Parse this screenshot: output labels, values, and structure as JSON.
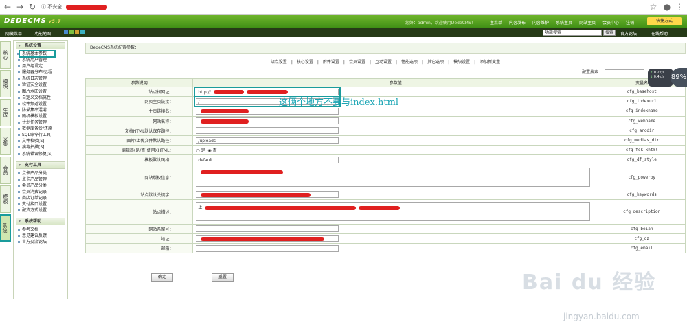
{
  "browser": {
    "insecure_label": "不安全"
  },
  "header": {
    "logo": "DEDECMS",
    "version": "v5.7",
    "welcome": "您好：admin，欢迎使用DedeCMS！",
    "nav": [
      "主菜单",
      "内容发布",
      "内容维护",
      "系统主页",
      "网站主页",
      "会员中心",
      "注销"
    ],
    "quick": "快捷方式"
  },
  "subbar": {
    "hide_menu": "隐藏菜单",
    "function_map": "功能地图",
    "search_value": "功能搜索",
    "search_btn": "搜索",
    "forum": "官方论坛",
    "help": "在线帮助"
  },
  "vtabs": [
    "常用",
    "核心",
    "模块",
    "生成",
    "采集",
    "会员",
    "模板",
    "系统"
  ],
  "sidebar": {
    "groups": [
      {
        "title": "系统设置",
        "items": [
          "系统基本参数",
          "系统用户管理",
          "用户组设定",
          "服务器分布/远程",
          "系统日志管理",
          "验证安全设置",
          "图片水印设置",
          "自定义文档属性",
          "软件频道设置",
          "防采集串混淆",
          "随机模板设置",
          "计划任务管理",
          "数据库备份/还原",
          "SQL命令行工具",
          "文件校验[S]",
          "病毒扫描[S]",
          "系统错误修复[S]"
        ]
      },
      {
        "title": "支付工具",
        "items": [
          "点卡产品分类",
          "点卡产品管理",
          "会员产品分类",
          "会员消费记录",
          "商店订单记录",
          "支付接口设置",
          "配货方式设置"
        ]
      },
      {
        "title": "系统帮助",
        "items": [
          "参考文档",
          "意见建议反馈",
          "官方交流论坛"
        ]
      }
    ]
  },
  "main": {
    "title": "DedeCMS系统配置参数：",
    "tabs": [
      "站点设置",
      "核心设置",
      "附件设置",
      "会员设置",
      "互动设置",
      "性能选项",
      "其它选项",
      "模块设置",
      "添加新变量"
    ],
    "config_search": "配置搜索：",
    "headers": [
      "参数说明",
      "参数值",
      "变量名"
    ],
    "rows": [
      {
        "label": "站点根网址：",
        "value": "http://",
        "var": "cfg_basehost"
      },
      {
        "label": "网页主页链接：",
        "value": "/",
        "var": "cfg_indexurl"
      },
      {
        "label": "主页链接名：",
        "value": "",
        "var": "cfg_indexname"
      },
      {
        "label": "网站名称：",
        "value": "",
        "var": "cfg_webname"
      },
      {
        "label": "文档HTML默认保存路径：",
        "value": "",
        "var": "cfg_arcdir"
      },
      {
        "label": "图片/上传文件默认路径：",
        "value": "/uploads",
        "var": "cfg_medias_dir"
      },
      {
        "label": "编辑器(是/否)使用XHTML：",
        "radio_yes": "是",
        "radio_no": "否",
        "var": "cfg_fck_xhtml"
      },
      {
        "label": "模板默认风格：",
        "value": "default",
        "var": "cfg_df_style"
      },
      {
        "label": "网站版权信息：",
        "value": "",
        "var": "cfg_powerby"
      },
      {
        "label": "站点默认关键字：",
        "value": "",
        "var": "cfg_keywords"
      },
      {
        "label": "站点描述：",
        "value": "上",
        "var": "cfg_description"
      },
      {
        "label": "网站备案号：",
        "value": "",
        "var": "cfg_beian"
      },
      {
        "label": "地址：",
        "value": "",
        "var": "cfg_dz"
      },
      {
        "label": "邮箱：",
        "value": "",
        "var": "cfg_email"
      }
    ],
    "ok": "确定",
    "reset": "重置"
  },
  "annotation": "这俩个地方不要与index.html",
  "speed": {
    "up": "0.2k/s",
    "down": "0.4k/s",
    "percent": "89%"
  },
  "watermark": {
    "text": "Bai du 经验",
    "url": "jingyan.baidu.com"
  }
}
